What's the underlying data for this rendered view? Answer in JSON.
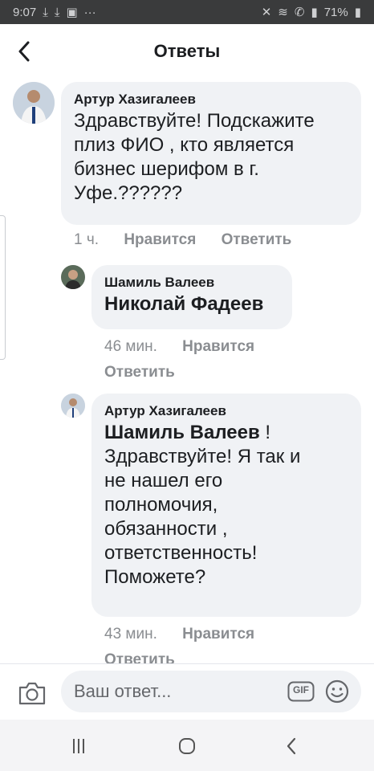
{
  "status_bar": {
    "time": "9:07",
    "left_icons": [
      "download-icon",
      "download-user-icon",
      "image-icon",
      "more-dots-icon"
    ],
    "right_icons": [
      "mute-icon",
      "wifi-icon",
      "call-icon",
      "signal-icon"
    ],
    "battery": "71%"
  },
  "header": {
    "title": "Ответы",
    "back_icon": "back-arrow-icon"
  },
  "comments": [
    {
      "author": "Артур Хазигалеев",
      "text_lines": [
        "Здравствуйте! Подскажите",
        "плиз ФИО , кто является",
        "бизнес шерифом в г.",
        "Уфе.??????"
      ],
      "time": "1 ч.",
      "like_label": "Нравится",
      "reply_label": "Ответить"
    },
    {
      "author": "Шамиль Валеев",
      "mention": "Николай Фадеев",
      "time": "46 мин.",
      "like_label": "Нравится",
      "reply_label": "Ответить"
    },
    {
      "author": "Артур Хазигалеев",
      "mention": "Шамиль Валеев",
      "after_mention": " !",
      "text_lines": [
        "Здравствуйте! Я так и",
        "не нашел его",
        "полномочия,",
        "обязанности ,",
        "ответственность!",
        "Поможете?"
      ],
      "time": "43 мин.",
      "like_label": "Нравится",
      "reply_label": "Ответить"
    }
  ],
  "composer": {
    "placeholder": "Ваш ответ...",
    "gif_label": "GIF",
    "camera_icon": "camera-icon",
    "emoji_icon": "emoji-icon"
  },
  "nav_bar": {
    "icons": [
      "recent-apps-icon",
      "home-icon",
      "back-icon"
    ]
  },
  "colors": {
    "status_bar_bg": "#3a3b3c",
    "bubble_bg": "#f0f2f5",
    "meta_text": "#8a8d91",
    "nav_bar_bg": "#f4f4f6"
  }
}
